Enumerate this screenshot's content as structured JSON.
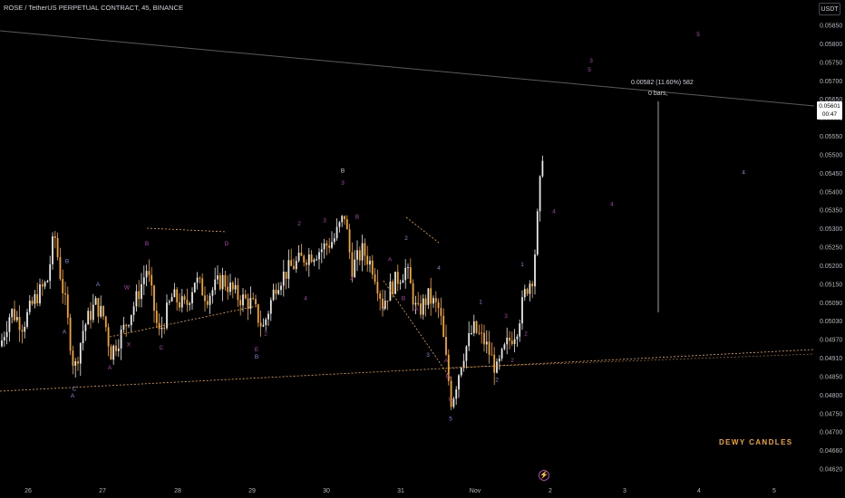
{
  "header": {
    "symbol_title": "ROSE / TetherUS PERPETUAL CONTRACT, 45, BINANCE",
    "currency": "USDT"
  },
  "chart_data": {
    "type": "candlestick",
    "x_ticks": [
      "26",
      "27",
      "28",
      "29",
      "30",
      "31",
      "Nov",
      "2",
      "3",
      "4",
      "5"
    ],
    "y_ticks": [
      "0.05850",
      "0.05800",
      "0.05750",
      "0.05700",
      "0.05650",
      "0.05600",
      "0.05550",
      "0.05500",
      "0.05450",
      "0.05400",
      "0.05350",
      "0.05300",
      "0.05250",
      "0.05200",
      "0.05150",
      "0.05100",
      "0.05050",
      "0.05000",
      "0.04950",
      "0.04900",
      "0.04850",
      "0.04800",
      "0.04750",
      "0.04700",
      "0.04650",
      "0.04600"
    ],
    "y_tick_labels": [
      "0.05850",
      "0.05800",
      "0.05750",
      "0.05700",
      "0.05650",
      "0.05601",
      "0.05550",
      "0.05500",
      "0.05450",
      "0.05400",
      "0.05350",
      "0.05300",
      "0.05250",
      "0.05200",
      "0.05150",
      "0.05090",
      "0.05030",
      "0.04970",
      "0.04910",
      "0.04850",
      "0.04800",
      "0.04750",
      "0.04700",
      "0.04660",
      "0.04620"
    ],
    "ylim": [
      0.0461,
      0.059
    ],
    "last_price": "0.05601",
    "countdown": "00:47",
    "measure": {
      "line1": "0.00582 (11.60%) 582",
      "line2": "0 bars,"
    },
    "watermark": "DEWY CANDLES",
    "price_path": [
      {
        "x": 0,
        "y": 0.05
      },
      {
        "x": 12,
        "y": 0.051
      },
      {
        "x": 25,
        "y": 0.0506
      },
      {
        "x": 40,
        "y": 0.0514
      },
      {
        "x": 52,
        "y": 0.0518
      },
      {
        "x": 60,
        "y": 0.0532
      },
      {
        "x": 66,
        "y": 0.0521
      },
      {
        "x": 72,
        "y": 0.0512
      },
      {
        "x": 82,
        "y": 0.0493
      },
      {
        "x": 92,
        "y": 0.0505
      },
      {
        "x": 105,
        "y": 0.0512
      },
      {
        "x": 115,
        "y": 0.0508
      },
      {
        "x": 122,
        "y": 0.0498
      },
      {
        "x": 135,
        "y": 0.0504
      },
      {
        "x": 150,
        "y": 0.0513
      },
      {
        "x": 162,
        "y": 0.0522
      },
      {
        "x": 175,
        "y": 0.0503
      },
      {
        "x": 190,
        "y": 0.0514
      },
      {
        "x": 205,
        "y": 0.0511
      },
      {
        "x": 215,
        "y": 0.0519
      },
      {
        "x": 228,
        "y": 0.0514
      },
      {
        "x": 245,
        "y": 0.0519
      },
      {
        "x": 262,
        "y": 0.0514
      },
      {
        "x": 278,
        "y": 0.0512
      },
      {
        "x": 290,
        "y": 0.0505
      },
      {
        "x": 305,
        "y": 0.0518
      },
      {
        "x": 320,
        "y": 0.0522
      },
      {
        "x": 335,
        "y": 0.0525
      },
      {
        "x": 352,
        "y": 0.0527
      },
      {
        "x": 368,
        "y": 0.053
      },
      {
        "x": 380,
        "y": 0.0537
      },
      {
        "x": 388,
        "y": 0.0522
      },
      {
        "x": 400,
        "y": 0.0527
      },
      {
        "x": 412,
        "y": 0.0522
      },
      {
        "x": 422,
        "y": 0.0512
      },
      {
        "x": 432,
        "y": 0.0517
      },
      {
        "x": 448,
        "y": 0.0522
      },
      {
        "x": 460,
        "y": 0.0509
      },
      {
        "x": 472,
        "y": 0.0514
      },
      {
        "x": 485,
        "y": 0.051
      },
      {
        "x": 498,
        "y": 0.0484
      },
      {
        "x": 510,
        "y": 0.0497
      },
      {
        "x": 522,
        "y": 0.0505
      },
      {
        "x": 535,
        "y": 0.0501
      },
      {
        "x": 548,
        "y": 0.0493
      },
      {
        "x": 558,
        "y": 0.05
      },
      {
        "x": 570,
        "y": 0.0505
      },
      {
        "x": 580,
        "y": 0.0516
      },
      {
        "x": 588,
        "y": 0.052
      },
      {
        "x": 594,
        "y": 0.054
      },
      {
        "x": 600,
        "y": 0.056
      }
    ],
    "wave_labels": [
      {
        "text": "A",
        "x": 71,
        "y": 0.05035,
        "color": "#7a8ce0"
      },
      {
        "text": "B",
        "x": 74,
        "y": 0.05235,
        "color": "#7a8ce0"
      },
      {
        "text": "C",
        "x": 82,
        "y": 0.04875,
        "color": "#7a8ce0"
      },
      {
        "text": "A",
        "x": 80,
        "y": 0.04855,
        "color": "#7a8ce0"
      },
      {
        "text": "A",
        "x": 108,
        "y": 0.0517,
        "color": "#7a8ce0"
      },
      {
        "text": "W",
        "x": 140,
        "y": 0.0516,
        "color": "#b03fb0"
      },
      {
        "text": "X",
        "x": 142,
        "y": 0.05,
        "color": "#b03fb0"
      },
      {
        "text": "A",
        "x": 121,
        "y": 0.04935,
        "color": "#b03fb0"
      },
      {
        "text": "B",
        "x": 162,
        "y": 0.05285,
        "color": "#b03fb0"
      },
      {
        "text": "C",
        "x": 178,
        "y": 0.0499,
        "color": "#b03fb0"
      },
      {
        "text": "D",
        "x": 250,
        "y": 0.05285,
        "color": "#b03fb0"
      },
      {
        "text": "E",
        "x": 283,
        "y": 0.04985,
        "color": "#b03fb0"
      },
      {
        "text": "B",
        "x": 283,
        "y": 0.04965,
        "color": "#7a8ce0"
      },
      {
        "text": "2",
        "x": 293,
        "y": 0.0503,
        "color": "#b03fb0"
      },
      {
        "text": "3",
        "x": 358,
        "y": 0.0535,
        "color": "#b03fb0"
      },
      {
        "text": "2",
        "x": 330,
        "y": 0.0534,
        "color": "#b03fb0"
      },
      {
        "text": "4",
        "x": 337,
        "y": 0.0513,
        "color": "#b03fb0"
      },
      {
        "text": "B",
        "x": 378,
        "y": 0.0549,
        "color": "#d1d4dc"
      },
      {
        "text": "3",
        "x": 378,
        "y": 0.05455,
        "color": "#b03fb0"
      },
      {
        "text": "B",
        "x": 394,
        "y": 0.0536,
        "color": "#b03fb0"
      },
      {
        "text": "4",
        "x": 388,
        "y": 0.05185,
        "color": "#b03fb0"
      },
      {
        "text": "A",
        "x": 430,
        "y": 0.0524,
        "color": "#b03fb0"
      },
      {
        "text": "B",
        "x": 445,
        "y": 0.0513,
        "color": "#b03fb0"
      },
      {
        "text": "2",
        "x": 448,
        "y": 0.053,
        "color": "#7a8ce0"
      },
      {
        "text": "4",
        "x": 484,
        "y": 0.05215,
        "color": "#7a8ce0"
      },
      {
        "text": "A",
        "x": 459,
        "y": 0.051,
        "color": "#b03fb0"
      },
      {
        "text": "B",
        "x": 494,
        "y": 0.0491,
        "color": "#b03fb0"
      },
      {
        "text": "1",
        "x": 423,
        "y": 0.051,
        "color": "#7a8ce0"
      },
      {
        "text": "3",
        "x": 472,
        "y": 0.0497,
        "color": "#7a8ce0"
      },
      {
        "text": "A",
        "x": 492,
        "y": 0.04955,
        "color": "#b03fb0"
      },
      {
        "text": "C",
        "x": 497,
        "y": 0.04845,
        "color": "#b03fb0"
      },
      {
        "text": "5",
        "x": 497,
        "y": 0.0479,
        "color": "#7a8ce0"
      },
      {
        "text": "1",
        "x": 530,
        "y": 0.0512,
        "color": "#7a8ce0"
      },
      {
        "text": "2",
        "x": 548,
        "y": 0.049,
        "color": "#7a8ce0"
      },
      {
        "text": "3",
        "x": 558,
        "y": 0.0508,
        "color": "#b03fb0"
      },
      {
        "text": "2",
        "x": 565,
        "y": 0.04955,
        "color": "#b03fb0"
      },
      {
        "text": "1",
        "x": 576,
        "y": 0.05225,
        "color": "#7a8ce0"
      },
      {
        "text": "2",
        "x": 580,
        "y": 0.0503,
        "color": "#b03fb0"
      },
      {
        "text": "4",
        "x": 611,
        "y": 0.05375,
        "color": "#b03fb0"
      },
      {
        "text": "4",
        "x": 675,
        "y": 0.05395,
        "color": "#b03fb0"
      },
      {
        "text": "3",
        "x": 652,
        "y": 0.058,
        "color": "#b03fb0"
      },
      {
        "text": "5",
        "x": 650,
        "y": 0.05775,
        "color": "#b03fb0"
      },
      {
        "text": "4",
        "x": 820,
        "y": 0.05485,
        "color": "#7a8ce0"
      },
      {
        "text": "5",
        "x": 770,
        "y": 0.05875,
        "color": "#b03fb0"
      }
    ]
  },
  "colors": {
    "background": "#000000",
    "candle_up": "#e8e8e8",
    "candle_down": "#f5a623",
    "wave_purple": "#b03fb0",
    "wave_blue": "#7a8ce0",
    "trendline": "#555555",
    "dotted": "#f5a623"
  }
}
